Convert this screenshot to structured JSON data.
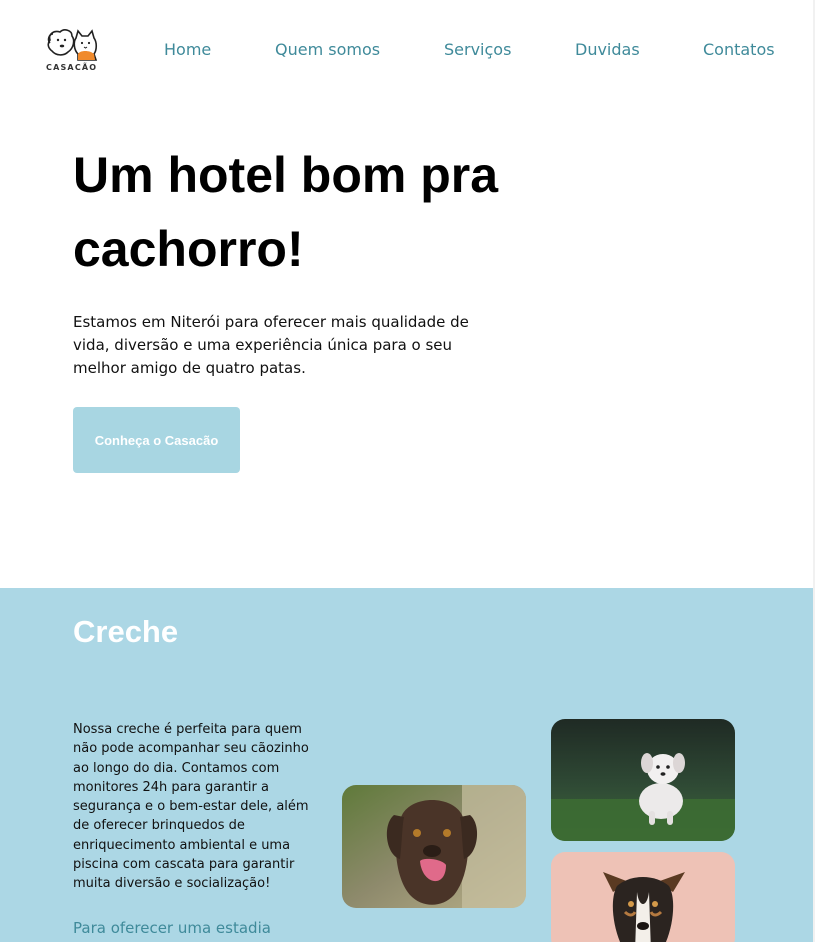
{
  "brand": {
    "name": "CASACÃO"
  },
  "nav": {
    "items": [
      {
        "label": "Home"
      },
      {
        "label": "Quem somos"
      },
      {
        "label": "Serviços"
      },
      {
        "label": "Duvidas"
      },
      {
        "label": "Contatos"
      }
    ]
  },
  "hero": {
    "title": "Um hotel bom pra cachorro!",
    "text": "Estamos em Niterói para oferecer mais qualidade de vida, diversão e uma experiência única para o seu melhor amigo de quatro patas.",
    "cta_label": "Conheça o Casacão"
  },
  "creche": {
    "title": "Creche",
    "text": "Nossa creche é perfeita para quem não pode acompanhar seu cãozinho ao longo do dia. Contamos com monitores 24h para garantir a segurança e o bem-estar dele, além de oferecer brinquedos de enriquecimento ambiental e uma piscina com cascata para garantir muita diversão e socialização!",
    "link_text": "Para oferecer uma estadia"
  },
  "colors": {
    "nav_link": "#3f8a9a",
    "cta_background": "#a8d6e2",
    "section_background": "#acd7e5"
  },
  "icons": {
    "logo": "dog-and-cat-logo-icon"
  }
}
